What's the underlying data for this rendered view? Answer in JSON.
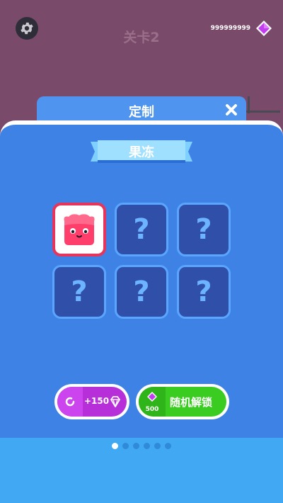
{
  "header": {
    "level_title": "关卡2",
    "currency_amount": "999999999",
    "settings_icon": "gear-icon",
    "currency_icon": "gem-icon"
  },
  "panel": {
    "title": "定制",
    "close_icon": "close-icon",
    "category": "果冻"
  },
  "grid": {
    "slots": [
      {
        "state": "selected",
        "content": "jelly-character"
      },
      {
        "state": "locked",
        "label": "?"
      },
      {
        "state": "locked",
        "label": "?"
      },
      {
        "state": "locked",
        "label": "?"
      },
      {
        "state": "locked",
        "label": "?"
      },
      {
        "state": "locked",
        "label": "?"
      }
    ]
  },
  "actions": {
    "ad_reward_label": "+150",
    "unlock_price": "500",
    "unlock_label": "随机解锁"
  },
  "pagination": {
    "total": 6,
    "active": 1
  },
  "colors": {
    "panel": "#3f82e6",
    "ad_button": "#b62fd9",
    "unlock_button": "#3bcc21",
    "selected_border": "#e8345a",
    "gem": "#c43cf0"
  }
}
